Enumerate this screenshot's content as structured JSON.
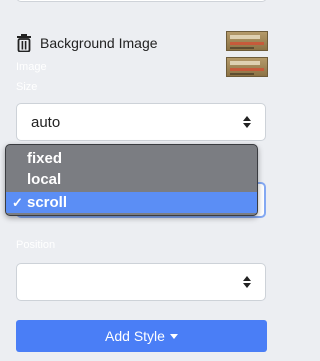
{
  "background_section": {
    "title": "Background Image",
    "image_label": "Image",
    "size_label": "Size",
    "size_value": "auto",
    "position_label": "Position",
    "position_value": ""
  },
  "attachment_dropdown": {
    "options": [
      "fixed",
      "local",
      "scroll"
    ],
    "selected": "scroll",
    "check_mark": "✓"
  },
  "add_style": {
    "label": "Add Style"
  },
  "colors": {
    "accent": "#4a7ef6",
    "dropdown_bg": "#7b7d82",
    "selected_row": "#5b8ef5"
  }
}
